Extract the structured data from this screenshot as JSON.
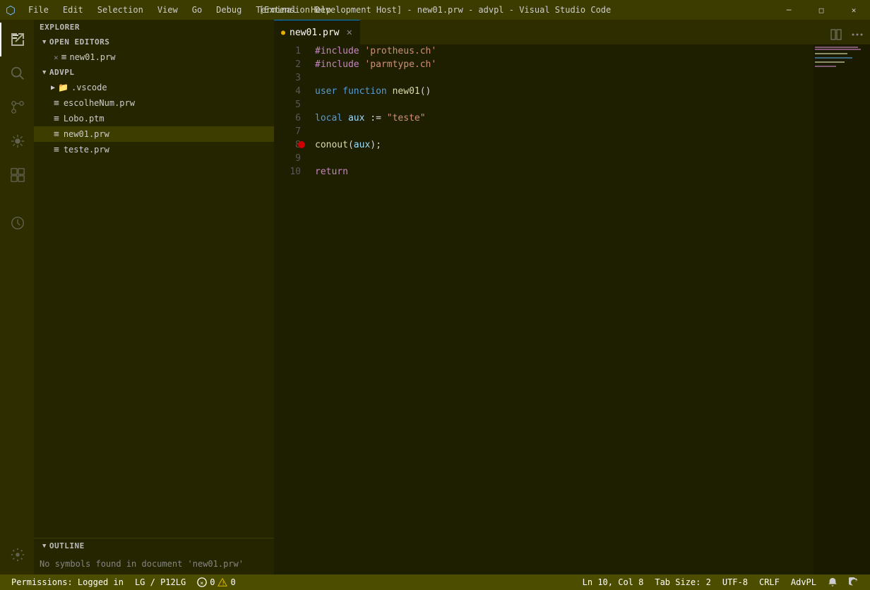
{
  "titleBar": {
    "logo": "⬡",
    "menuItems": [
      "File",
      "Edit",
      "Selection",
      "View",
      "Go",
      "Debug",
      "Terminal",
      "Help"
    ],
    "title": "[Extension Development Host] - new01.prw - advpl - Visual Studio Code",
    "windowControls": {
      "minimize": "─",
      "maximize": "□",
      "close": "✕"
    }
  },
  "activityBar": {
    "items": [
      {
        "name": "explorer",
        "icon": "⊞",
        "active": true
      },
      {
        "name": "search",
        "icon": "🔍",
        "active": false
      },
      {
        "name": "source-control",
        "icon": "⑂",
        "active": false
      },
      {
        "name": "debug",
        "icon": "⚙",
        "active": false
      },
      {
        "name": "extensions",
        "icon": "⊡",
        "active": false
      },
      {
        "name": "advpl",
        "icon": "◷",
        "active": false
      }
    ],
    "bottomItems": [
      {
        "name": "settings",
        "icon": "⚙"
      }
    ]
  },
  "sidebar": {
    "explorerTitle": "EXPLORER",
    "sections": {
      "openEditors": {
        "title": "OPEN EDITORS",
        "items": [
          {
            "name": "new01.prw",
            "dirty": true,
            "icon": "≡"
          }
        ]
      },
      "advpl": {
        "title": "ADVPL",
        "items": [
          {
            "name": ".vscode",
            "isFolder": true,
            "icon": "▶"
          },
          {
            "name": "escolheNum.prw",
            "icon": "≡"
          },
          {
            "name": "Lobo.ptm",
            "icon": "≡"
          },
          {
            "name": "new01.prw",
            "icon": "≡",
            "active": true
          },
          {
            "name": "teste.prw",
            "icon": "≡"
          }
        ]
      }
    },
    "outline": {
      "title": "OUTLINE",
      "message": "No symbols found in document 'new01.prw'"
    }
  },
  "editor": {
    "tabs": [
      {
        "name": "new01.prw",
        "dirty": true,
        "active": true
      }
    ],
    "code": [
      {
        "lineNum": 1,
        "content": "#include 'protheus.ch'",
        "tokens": [
          {
            "text": "#include ",
            "class": "kw-include"
          },
          {
            "text": "'protheus.ch'",
            "class": "kw-string"
          }
        ]
      },
      {
        "lineNum": 2,
        "content": "#include 'parmtype.ch'",
        "tokens": [
          {
            "text": "#include ",
            "class": "kw-include"
          },
          {
            "text": "'parmtype.ch'",
            "class": "kw-string"
          }
        ]
      },
      {
        "lineNum": 3,
        "content": "",
        "tokens": []
      },
      {
        "lineNum": 4,
        "content": "user function new01()",
        "tokens": [
          {
            "text": "user ",
            "class": "kw-user"
          },
          {
            "text": "function ",
            "class": "kw-user"
          },
          {
            "text": "new01",
            "class": "kw-name"
          },
          {
            "text": "()",
            "class": "kw-operator"
          }
        ]
      },
      {
        "lineNum": 5,
        "content": "",
        "tokens": []
      },
      {
        "lineNum": 6,
        "content": "local aux := \"teste\"",
        "tokens": [
          {
            "text": "local ",
            "class": "kw-local"
          },
          {
            "text": "aux",
            "class": "kw-var"
          },
          {
            "text": " := ",
            "class": "kw-operator"
          },
          {
            "text": "\"teste\"",
            "class": "kw-string"
          }
        ]
      },
      {
        "lineNum": 7,
        "content": "",
        "tokens": []
      },
      {
        "lineNum": 8,
        "content": "conout(aux);",
        "tokens": [
          {
            "text": "conout",
            "class": "kw-name"
          },
          {
            "text": "(",
            "class": "kw-operator"
          },
          {
            "text": "aux",
            "class": "kw-var"
          },
          {
            "text": ");",
            "class": "kw-operator"
          }
        ],
        "breakpoint": true
      },
      {
        "lineNum": 9,
        "content": "",
        "tokens": []
      },
      {
        "lineNum": 10,
        "content": "return",
        "tokens": [
          {
            "text": "return",
            "class": "kw-return"
          }
        ]
      }
    ]
  },
  "statusBar": {
    "permissions": "Permissions: Logged in",
    "lg": "LG / P12LG",
    "errors": "0",
    "warnings": "0",
    "position": "Ln 10, Col 8",
    "tabSize": "Tab Size: 2",
    "encoding": "UTF-8",
    "lineEnding": "CRLF",
    "language": "AdvPL",
    "bell": "🔔",
    "sync": "↻"
  }
}
